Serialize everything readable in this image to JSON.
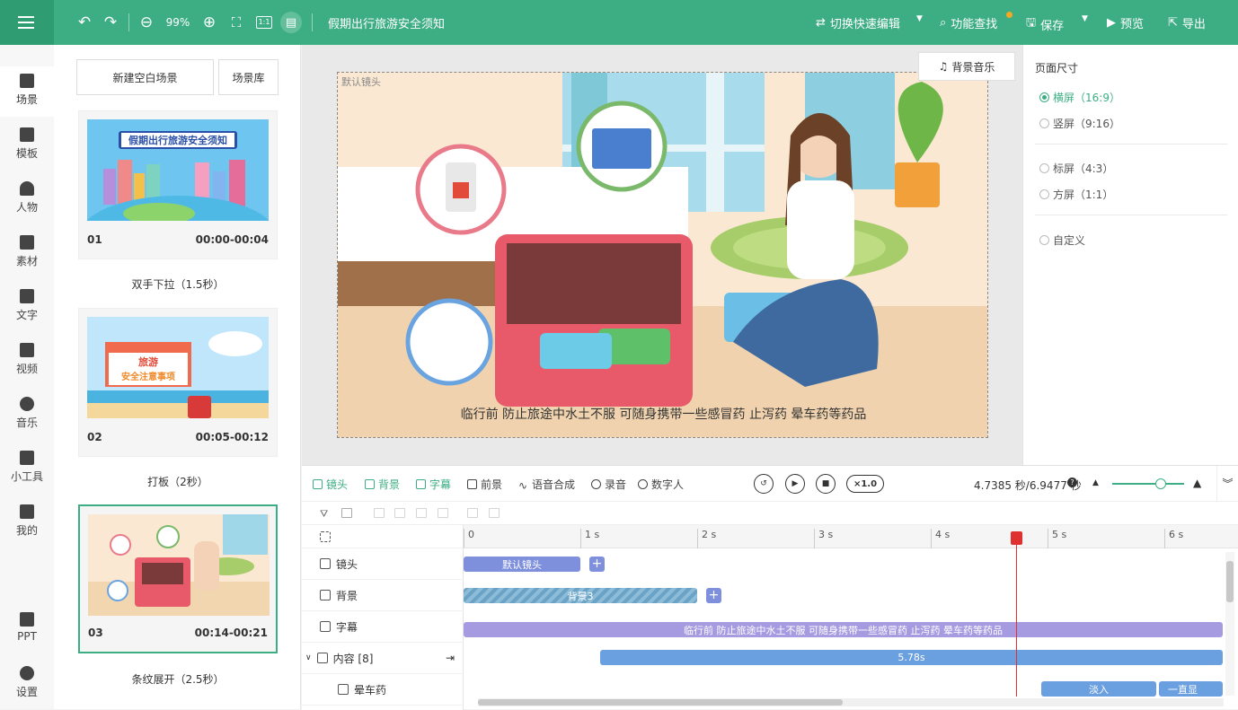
{
  "toolbar": {
    "zoom": "99%",
    "ratio_label": "1:1",
    "title": "假期出行旅游安全须知",
    "quick_edit": "切换快速编辑",
    "find": "功能查找",
    "save": "保存",
    "preview": "预览",
    "export": "导出"
  },
  "nav": [
    {
      "label": "场景"
    },
    {
      "label": "模板"
    },
    {
      "label": "人物"
    },
    {
      "label": "素材"
    },
    {
      "label": "文字"
    },
    {
      "label": "视频"
    },
    {
      "label": "音乐"
    },
    {
      "label": "小工具"
    },
    {
      "label": "我的"
    },
    {
      "label": "PPT"
    },
    {
      "label": "设置"
    }
  ],
  "scene_panel": {
    "new_blank": "新建空白场景",
    "library": "场景库",
    "scenes": [
      {
        "no": "01",
        "time": "00:00-00:04",
        "transition": "双手下拉（1.5秒）",
        "thumb_title": "假期出行旅游安全须知"
      },
      {
        "no": "02",
        "time": "00:05-00:12",
        "transition": "打板（2秒）",
        "thumb_title_1": "旅游",
        "thumb_title_2": "安全注意事项"
      },
      {
        "no": "03",
        "time": "00:14-00:21",
        "transition": "条纹展开（2.5秒）"
      }
    ]
  },
  "canvas": {
    "lens_label": "默认镜头",
    "music_button": "背景音乐",
    "subtitle": "临行前 防止旅途中水土不服 可随身携带一些感冒药 止泻药 晕车药等药品"
  },
  "right_panel": {
    "title": "页面尺寸",
    "options": [
      {
        "label": "横屏（16:9）",
        "selected": true
      },
      {
        "label": "竖屏（9:16）",
        "selected": false
      },
      {
        "label": "标屏（4:3）",
        "selected": false
      },
      {
        "label": "方屏（1:1）",
        "selected": false
      },
      {
        "label": "自定义",
        "selected": false
      }
    ]
  },
  "timeline": {
    "tabs": [
      "镜头",
      "背景",
      "字幕",
      "前景",
      "语音合成",
      "录音",
      "数字人"
    ],
    "speed": "×1.0",
    "time": "4.7385 秒/6.9477 秒",
    "ruler": [
      "0",
      "1 s",
      "2 s",
      "3 s",
      "4 s",
      "5 s",
      "6 s"
    ],
    "rows": [
      {
        "label": "镜头"
      },
      {
        "label": "背景"
      },
      {
        "label": "字幕"
      },
      {
        "label": "内容 [8]"
      },
      {
        "label": "晕车药"
      }
    ],
    "tracks": {
      "lens": "默认镜头",
      "background": "背景3",
      "subtitle": "临行前 防止旅途中水土不服 可随身携带一些感冒药 止泻药 晕车药等药品",
      "content": "5.78s",
      "fade_in": "淡入",
      "always": "一直显"
    }
  },
  "colors": {
    "primary": "#3dae84",
    "playhead": "#e03131",
    "track_blue": "#7e8fdc",
    "track_purple": "#a69be0",
    "track_content": "#6a9fe0"
  }
}
